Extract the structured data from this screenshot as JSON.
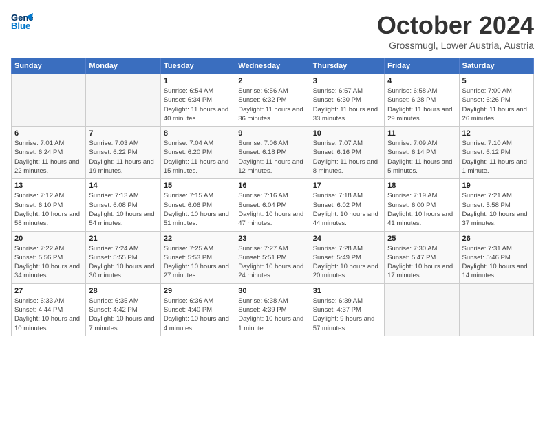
{
  "header": {
    "logo_line1": "General",
    "logo_line2": "Blue",
    "month_title": "October 2024",
    "subtitle": "Grossmugl, Lower Austria, Austria"
  },
  "days_of_week": [
    "Sunday",
    "Monday",
    "Tuesday",
    "Wednesday",
    "Thursday",
    "Friday",
    "Saturday"
  ],
  "weeks": [
    [
      {
        "day": "",
        "empty": true
      },
      {
        "day": "",
        "empty": true
      },
      {
        "day": "1",
        "sunrise": "Sunrise: 6:54 AM",
        "sunset": "Sunset: 6:34 PM",
        "daylight": "Daylight: 11 hours and 40 minutes."
      },
      {
        "day": "2",
        "sunrise": "Sunrise: 6:56 AM",
        "sunset": "Sunset: 6:32 PM",
        "daylight": "Daylight: 11 hours and 36 minutes."
      },
      {
        "day": "3",
        "sunrise": "Sunrise: 6:57 AM",
        "sunset": "Sunset: 6:30 PM",
        "daylight": "Daylight: 11 hours and 33 minutes."
      },
      {
        "day": "4",
        "sunrise": "Sunrise: 6:58 AM",
        "sunset": "Sunset: 6:28 PM",
        "daylight": "Daylight: 11 hours and 29 minutes."
      },
      {
        "day": "5",
        "sunrise": "Sunrise: 7:00 AM",
        "sunset": "Sunset: 6:26 PM",
        "daylight": "Daylight: 11 hours and 26 minutes."
      }
    ],
    [
      {
        "day": "6",
        "sunrise": "Sunrise: 7:01 AM",
        "sunset": "Sunset: 6:24 PM",
        "daylight": "Daylight: 11 hours and 22 minutes."
      },
      {
        "day": "7",
        "sunrise": "Sunrise: 7:03 AM",
        "sunset": "Sunset: 6:22 PM",
        "daylight": "Daylight: 11 hours and 19 minutes."
      },
      {
        "day": "8",
        "sunrise": "Sunrise: 7:04 AM",
        "sunset": "Sunset: 6:20 PM",
        "daylight": "Daylight: 11 hours and 15 minutes."
      },
      {
        "day": "9",
        "sunrise": "Sunrise: 7:06 AM",
        "sunset": "Sunset: 6:18 PM",
        "daylight": "Daylight: 11 hours and 12 minutes."
      },
      {
        "day": "10",
        "sunrise": "Sunrise: 7:07 AM",
        "sunset": "Sunset: 6:16 PM",
        "daylight": "Daylight: 11 hours and 8 minutes."
      },
      {
        "day": "11",
        "sunrise": "Sunrise: 7:09 AM",
        "sunset": "Sunset: 6:14 PM",
        "daylight": "Daylight: 11 hours and 5 minutes."
      },
      {
        "day": "12",
        "sunrise": "Sunrise: 7:10 AM",
        "sunset": "Sunset: 6:12 PM",
        "daylight": "Daylight: 11 hours and 1 minute."
      }
    ],
    [
      {
        "day": "13",
        "sunrise": "Sunrise: 7:12 AM",
        "sunset": "Sunset: 6:10 PM",
        "daylight": "Daylight: 10 hours and 58 minutes."
      },
      {
        "day": "14",
        "sunrise": "Sunrise: 7:13 AM",
        "sunset": "Sunset: 6:08 PM",
        "daylight": "Daylight: 10 hours and 54 minutes."
      },
      {
        "day": "15",
        "sunrise": "Sunrise: 7:15 AM",
        "sunset": "Sunset: 6:06 PM",
        "daylight": "Daylight: 10 hours and 51 minutes."
      },
      {
        "day": "16",
        "sunrise": "Sunrise: 7:16 AM",
        "sunset": "Sunset: 6:04 PM",
        "daylight": "Daylight: 10 hours and 47 minutes."
      },
      {
        "day": "17",
        "sunrise": "Sunrise: 7:18 AM",
        "sunset": "Sunset: 6:02 PM",
        "daylight": "Daylight: 10 hours and 44 minutes."
      },
      {
        "day": "18",
        "sunrise": "Sunrise: 7:19 AM",
        "sunset": "Sunset: 6:00 PM",
        "daylight": "Daylight: 10 hours and 41 minutes."
      },
      {
        "day": "19",
        "sunrise": "Sunrise: 7:21 AM",
        "sunset": "Sunset: 5:58 PM",
        "daylight": "Daylight: 10 hours and 37 minutes."
      }
    ],
    [
      {
        "day": "20",
        "sunrise": "Sunrise: 7:22 AM",
        "sunset": "Sunset: 5:56 PM",
        "daylight": "Daylight: 10 hours and 34 minutes."
      },
      {
        "day": "21",
        "sunrise": "Sunrise: 7:24 AM",
        "sunset": "Sunset: 5:55 PM",
        "daylight": "Daylight: 10 hours and 30 minutes."
      },
      {
        "day": "22",
        "sunrise": "Sunrise: 7:25 AM",
        "sunset": "Sunset: 5:53 PM",
        "daylight": "Daylight: 10 hours and 27 minutes."
      },
      {
        "day": "23",
        "sunrise": "Sunrise: 7:27 AM",
        "sunset": "Sunset: 5:51 PM",
        "daylight": "Daylight: 10 hours and 24 minutes."
      },
      {
        "day": "24",
        "sunrise": "Sunrise: 7:28 AM",
        "sunset": "Sunset: 5:49 PM",
        "daylight": "Daylight: 10 hours and 20 minutes."
      },
      {
        "day": "25",
        "sunrise": "Sunrise: 7:30 AM",
        "sunset": "Sunset: 5:47 PM",
        "daylight": "Daylight: 10 hours and 17 minutes."
      },
      {
        "day": "26",
        "sunrise": "Sunrise: 7:31 AM",
        "sunset": "Sunset: 5:46 PM",
        "daylight": "Daylight: 10 hours and 14 minutes."
      }
    ],
    [
      {
        "day": "27",
        "sunrise": "Sunrise: 6:33 AM",
        "sunset": "Sunset: 4:44 PM",
        "daylight": "Daylight: 10 hours and 10 minutes."
      },
      {
        "day": "28",
        "sunrise": "Sunrise: 6:35 AM",
        "sunset": "Sunset: 4:42 PM",
        "daylight": "Daylight: 10 hours and 7 minutes."
      },
      {
        "day": "29",
        "sunrise": "Sunrise: 6:36 AM",
        "sunset": "Sunset: 4:40 PM",
        "daylight": "Daylight: 10 hours and 4 minutes."
      },
      {
        "day": "30",
        "sunrise": "Sunrise: 6:38 AM",
        "sunset": "Sunset: 4:39 PM",
        "daylight": "Daylight: 10 hours and 1 minute."
      },
      {
        "day": "31",
        "sunrise": "Sunrise: 6:39 AM",
        "sunset": "Sunset: 4:37 PM",
        "daylight": "Daylight: 9 hours and 57 minutes."
      },
      {
        "day": "",
        "empty": true
      },
      {
        "day": "",
        "empty": true
      }
    ]
  ]
}
